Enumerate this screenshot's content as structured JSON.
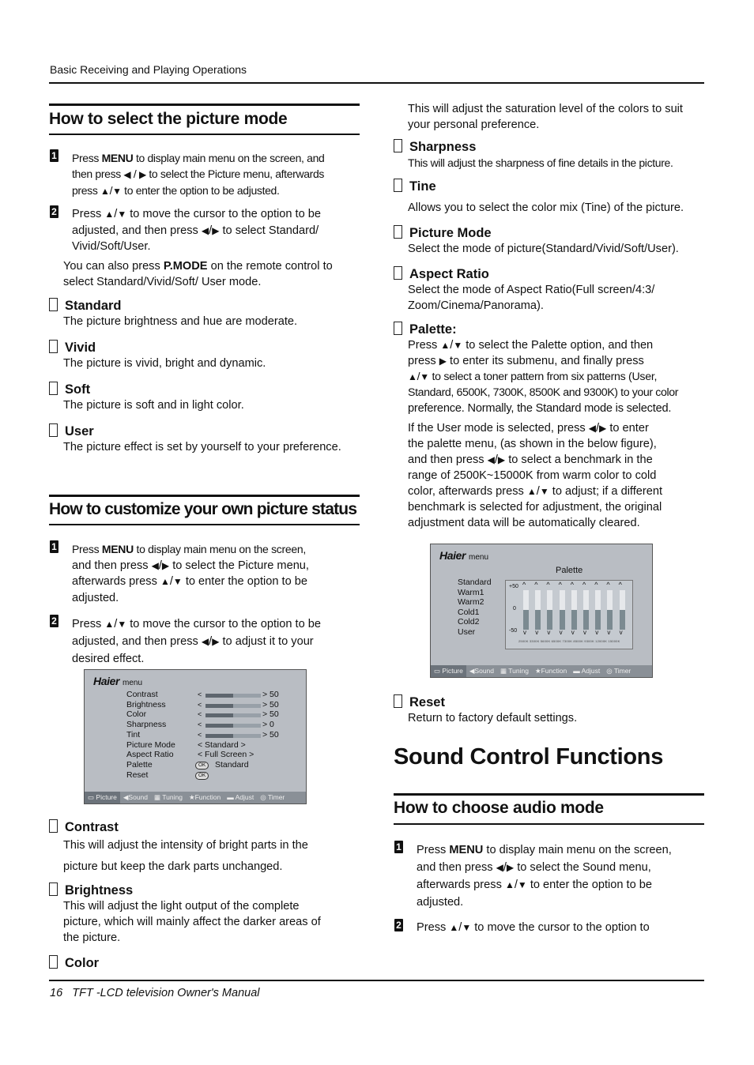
{
  "header": {
    "running_title": "Basic Receiving and Playing Operations"
  },
  "footer": {
    "page_number": "16",
    "manual_title": "TFT -LCD  television  Owner's Manual"
  },
  "glyphs": {
    "left": "◀",
    "right": "▶",
    "up": "▲",
    "down": "▼",
    "slash": "/"
  },
  "left": {
    "sec1": {
      "title": "How to select the picture mode",
      "step1": {
        "num": "1",
        "a": "Press ",
        "key": "MENU",
        "b": " to display main menu on the screen, and",
        "c": "then press ",
        "d": " to select the Picture menu, afterwards",
        "e": "press ",
        "f": " to enter the option to be adjusted."
      },
      "step2": {
        "num": "2",
        "a": "Press ",
        "b": " to move the cursor to the option to be",
        "c": "adjusted, and then press ",
        "d": " to select Standard/",
        "e": "Vivid/Soft/User."
      },
      "note": {
        "a": "You can also press ",
        "key": "P.MODE",
        "b": " on the remote control to",
        "c": "select Standard/Vivid/Soft/ User mode."
      },
      "items": [
        {
          "title": "Standard",
          "desc": "The picture brightness and hue are moderate."
        },
        {
          "title": "Vivid",
          "desc": "The picture is vivid, bright and dynamic."
        },
        {
          "title": "Soft",
          "desc": "The picture is soft and in light color."
        },
        {
          "title": "User",
          "desc": "The picture effect is set by yourself to your preference."
        }
      ]
    },
    "sec2": {
      "title": "How to customize your own picture status",
      "step1": {
        "num": "1",
        "a": "Press ",
        "key": "MENU",
        "b": " to display main menu on the screen,",
        "c": "and then press ",
        "d": " to select the Picture menu,",
        "e": "afterwards press ",
        "f": " to enter the option to be",
        "g": "adjusted."
      },
      "step2": {
        "num": "2",
        "a": "Press ",
        "b": " to move the cursor to the option to be",
        "c": "adjusted, and then press ",
        "d": " to adjust it to your",
        "e": "desired effect."
      },
      "items": [
        {
          "title": "Contrast",
          "desc1": "This will adjust the intensity of bright parts in the",
          "desc2": "picture but keep the dark parts unchanged."
        },
        {
          "title": "Brightness",
          "desc1": "This will adjust the light output of the complete",
          "desc2": "picture, which will mainly affect the darker areas of",
          "desc3": "the picture."
        },
        {
          "title": "Color"
        }
      ]
    },
    "picture_menu": {
      "brand": "Haier",
      "menu_label": "menu",
      "sliders": [
        {
          "label": "Contrast",
          "value": "50",
          "fill": 0.5
        },
        {
          "label": "Brightness",
          "value": "50",
          "fill": 0.5
        },
        {
          "label": "Color",
          "value": "50",
          "fill": 0.5
        },
        {
          "label": "Sharpness",
          "value": "0",
          "fill": 0.5
        },
        {
          "label": "Tint",
          "value": "50",
          "fill": 0.5
        }
      ],
      "options": [
        {
          "label": "Picture Mode",
          "value": "Standard"
        },
        {
          "label": "Aspect Ratio",
          "value": "Full Screen"
        },
        {
          "label": "Palette",
          "value": "Standard",
          "ok": "OK"
        },
        {
          "label": "Reset",
          "value": "",
          "ok": "OK"
        }
      ],
      "arrow_left": "<",
      "arrow_right": ">",
      "nav": [
        "Picture",
        "Sound",
        "Tuning",
        "Function",
        "Adjust",
        "Timer"
      ],
      "nav_selected": "Picture"
    }
  },
  "right": {
    "color_desc": {
      "l1": "This will adjust the saturation level of the colors to suit",
      "l2": "your personal preference."
    },
    "items": [
      {
        "title": "Sharpness",
        "desc": "This will adjust the sharpness of fine details in the picture."
      },
      {
        "title": "Tine",
        "desc": "Allows you to select the color mix (Tine) of the picture."
      },
      {
        "title": "Picture Mode",
        "desc": "Select the mode of picture(Standard/Vivid/Soft/User)."
      },
      {
        "title": "Aspect Ratio",
        "desc1": "Select the mode of Aspect Ratio(Full screen/4:3/",
        "desc2": "Zoom/Cinema/Panorama)."
      }
    ],
    "palette": {
      "title": "Palette:",
      "p1": {
        "a": "Press ",
        "b": " to select the Palette option, and then",
        "c": "press ",
        "d": " to enter its submenu, and finally press",
        "e": " to select a toner pattern from six patterns (User,",
        "f": "Standard, 6500K, 7300K, 8500K and 9300K) to your color",
        "g": "preference. Normally, the Standard mode is selected."
      },
      "p2": {
        "a": "If the User mode is selected, press ",
        "b": " to enter",
        "c": "the palette menu, (as shown in the below figure),",
        "d": "and then press ",
        "e": " to select a benchmark in the",
        "f": "range of 2500K~15000K from warm color to cold",
        "g": "color, afterwards press ",
        "h": " to adjust; if a different",
        "i": "benchmark is selected for adjustment, the original",
        "j": "adjustment data will be automatically cleared."
      }
    },
    "palette_menu": {
      "brand": "Haier",
      "menu_label": "menu",
      "title": "Palette",
      "modes": [
        "Standard",
        "Warm1",
        "Warm2",
        "Cold1",
        "Cold2",
        "User"
      ],
      "scale": {
        "top": "+50",
        "mid": "0",
        "bottom": "-50"
      },
      "columns": 9,
      "levels": [
        0,
        0,
        0,
        0,
        0,
        0,
        0,
        0,
        0
      ],
      "up_glyph": "^",
      "down_glyph": "v",
      "nav": [
        "Picture",
        "Sound",
        "Tuning",
        "Function",
        "Adjust",
        "Timer"
      ],
      "nav_selected": "Picture"
    },
    "reset": {
      "title": "Reset",
      "desc": "Return to factory default settings."
    },
    "sound": {
      "h1": "Sound Control Functions",
      "sec_title": "How to choose audio mode",
      "step1": {
        "num": "1",
        "a": "Press ",
        "key": "MENU",
        "b": " to display main menu on the screen,",
        "c": "and then press ",
        "d": " to select the Sound menu,",
        "e": "afterwards press ",
        "f": " to enter the option to be",
        "g": "adjusted."
      },
      "step2": {
        "num": "2",
        "a": "Press ",
        "b": " to move the cursor to the option to"
      }
    }
  }
}
